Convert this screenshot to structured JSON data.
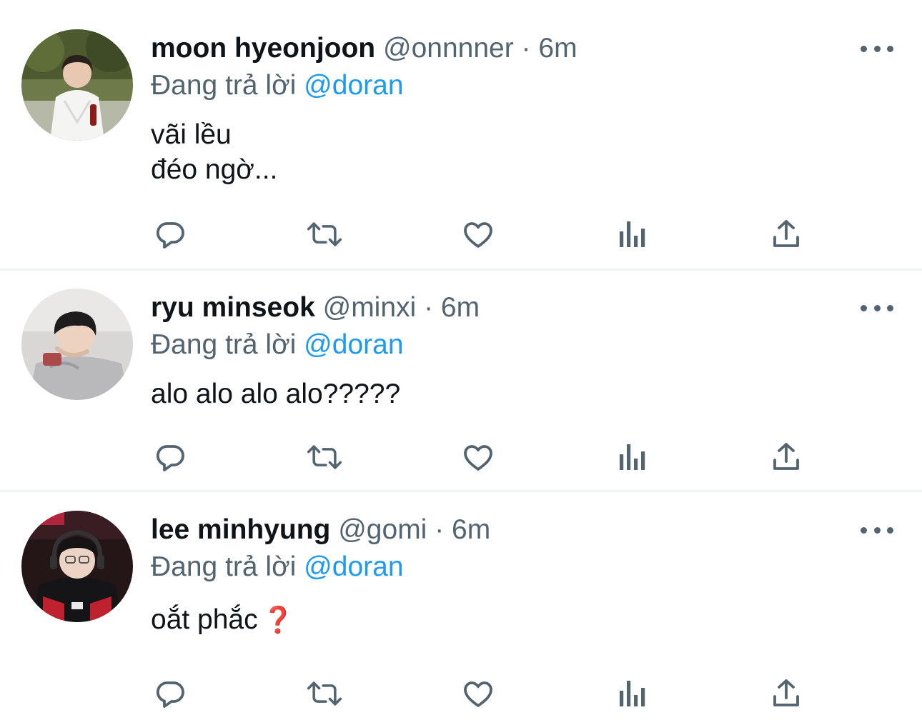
{
  "tweets": [
    {
      "name": "moon hyeonjoon",
      "handle": "@onnnner",
      "separator": "·",
      "time": "6m",
      "replying_prefix": "Đang trả lời",
      "replying_to": "@doran",
      "text": "vãi lều\nđéo ngờ...",
      "emoji": ""
    },
    {
      "name": "ryu minseok",
      "handle": "@minxi",
      "separator": "·",
      "time": "6m",
      "replying_prefix": "Đang trả lời",
      "replying_to": "@doran",
      "text": "alo alo alo alo?????",
      "emoji": ""
    },
    {
      "name": "lee minhyung",
      "handle": "@gomi",
      "separator": "·",
      "time": "6m",
      "replying_prefix": "Đang trả lời",
      "replying_to": "@doran",
      "text": "oắt phắc",
      "emoji": "❓"
    }
  ],
  "icons": {
    "actions": [
      "reply-icon",
      "retweet-icon",
      "like-icon",
      "views-icon",
      "share-icon"
    ],
    "more": "more-icon"
  },
  "colors": {
    "name": "#0f1419",
    "secondary": "#536471",
    "mention": "#1d9bf0",
    "divider": "#eff3f4",
    "emoji": "#dd2e44"
  }
}
